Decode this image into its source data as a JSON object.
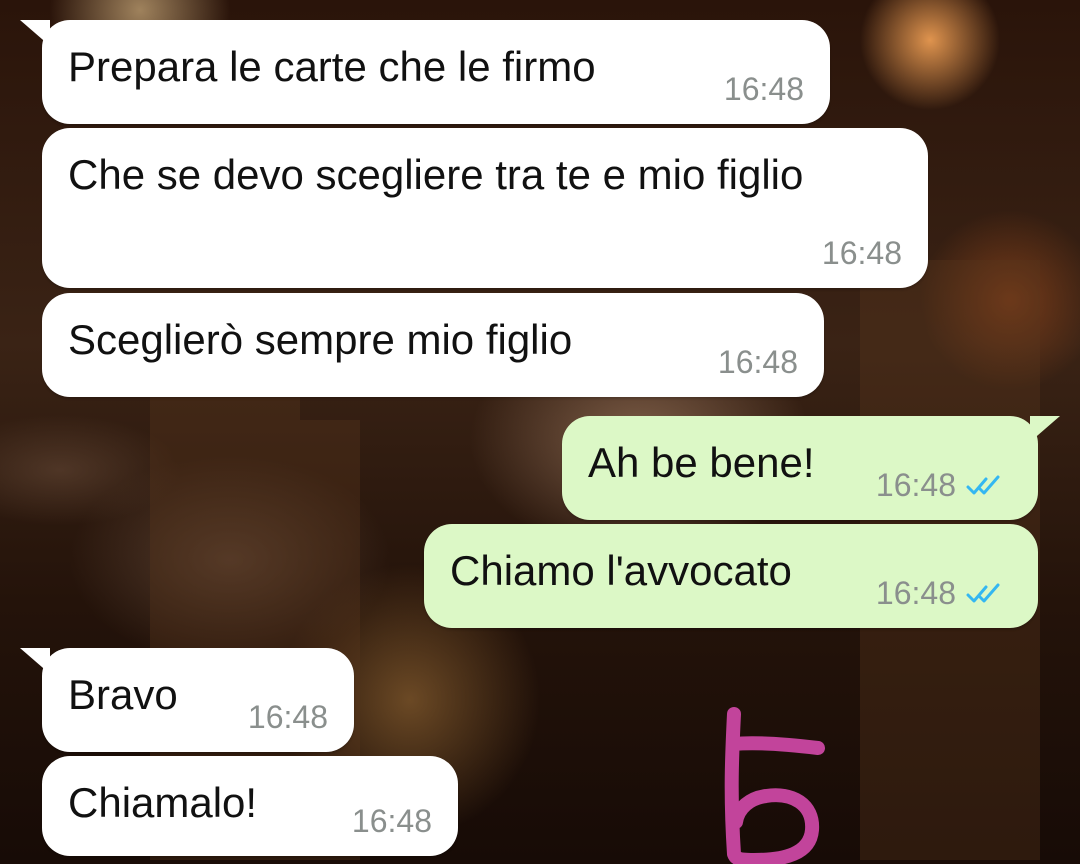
{
  "chat": {
    "messages": [
      {
        "direction": "incoming",
        "text": "Prepara le carte che le firmo",
        "time": "16:48"
      },
      {
        "direction": "incoming",
        "text": "Che se devo scegliere tra te e mio figlio",
        "time": "16:48"
      },
      {
        "direction": "incoming",
        "text": "Sceglierò sempre mio figlio",
        "time": "16:48"
      },
      {
        "direction": "outgoing",
        "text": "Ah be bene!",
        "time": "16:48",
        "status_icon": "double-check-read-icon"
      },
      {
        "direction": "outgoing",
        "text": "Chiamo l'avvocato",
        "time": "16:48",
        "status_icon": "double-check-read-icon"
      },
      {
        "direction": "incoming",
        "text": "Bravo",
        "time": "16:48"
      },
      {
        "direction": "incoming",
        "text": "Chiamalo!",
        "time": "16:48"
      }
    ]
  },
  "colors": {
    "incoming_bubble": "#ffffff",
    "outgoing_bubble": "#dcf8c6",
    "read_check": "#34b7f1",
    "timestamp": "#8a8f8d",
    "annotation_stroke": "#c2449b"
  },
  "annotation": {
    "icon": "handwritten-number-6"
  }
}
